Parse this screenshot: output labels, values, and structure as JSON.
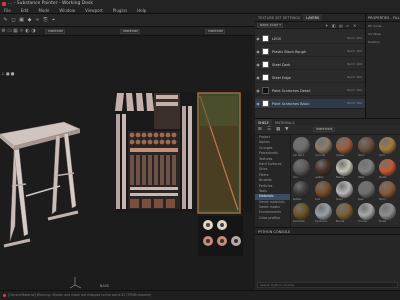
{
  "window": {
    "title": "... - Substance Painter - Working Desk"
  },
  "menu": [
    "File",
    "Edit",
    "Mode",
    "Window",
    "Viewport",
    "Plugins",
    "Help"
  ],
  "viewport_bar": {
    "left_dropdown": "Material",
    "mid_dropdown": "Material",
    "right_dropdown": "Material"
  },
  "texture_set_tabs": [
    {
      "label": "TEXTURE SET SETTINGS",
      "active": false
    },
    {
      "label": "LAYERS",
      "active": true
    }
  ],
  "layers": {
    "blend_mode": "Base color",
    "items": [
      {
        "name": "LEGS",
        "blend": "Norm\n100",
        "thumb": "white",
        "selected": false
      },
      {
        "name": "Plastic Black Rough",
        "blend": "Norm\n100",
        "thumb": "white",
        "selected": false
      },
      {
        "name": "Steel Dark",
        "blend": "Norm\n100",
        "thumb": "white",
        "selected": false
      },
      {
        "name": "Steel Edge",
        "blend": "Norm\n100",
        "thumb": "white",
        "selected": false
      },
      {
        "name": "Paint Scratches Detail",
        "blend": "Norm\n100",
        "thumb": "dark",
        "selected": false
      },
      {
        "name": "Paint Scratches Basic",
        "blend": "Norm\n100",
        "thumb": "white",
        "selected": true
      }
    ]
  },
  "properties": {
    "title": "PROPERTIES - FILL",
    "rows": [
      "Fill mode",
      "UV Wrap",
      "Position"
    ]
  },
  "shelf": {
    "tabs": [
      {
        "label": "SHELF",
        "active": true
      },
      {
        "label": "MATERIALS",
        "active": false
      }
    ],
    "search_label": "Materials",
    "categories": [
      "Project",
      "Alphas",
      "Grunges",
      "Procedurals",
      "Textures",
      "Hard Surfaces",
      "Skins",
      "Filters",
      "Brushes",
      "Particles",
      "Tools",
      "Materials",
      "Smart materials",
      "Smart masks",
      "Environments",
      "Color profiles"
    ],
    "selected_category": "Materials",
    "materials": [
      {
        "label": "Car Paint",
        "color": "#6e6e6e"
      },
      {
        "label": "Concrete",
        "color": "#8b7d6a"
      },
      {
        "label": "Copper",
        "color": "#9c5a3a"
      },
      {
        "label": "Fabric",
        "color": "#6b4f3e"
      },
      {
        "label": "Gold",
        "color": "#a27a3a"
      },
      {
        "label": "Iron",
        "color": "#5a5a5a"
      },
      {
        "label": "Leather",
        "color": "#4a2f24"
      },
      {
        "label": "Marble",
        "color": "#c8c3b8"
      },
      {
        "label": "Metal",
        "color": "#808080"
      },
      {
        "label": "Plastic",
        "color": "#c7562f"
      },
      {
        "label": "Rubber",
        "color": "#3a3a3a"
      },
      {
        "label": "Rust",
        "color": "#7a4a2a"
      },
      {
        "label": "Silver",
        "color": "#b8b8b8"
      },
      {
        "label": "Steel",
        "color": "#6e6e6e"
      },
      {
        "label": "Wood",
        "color": "#8a5a34"
      },
      {
        "label": "Gold Dark",
        "color": "#6b5220"
      },
      {
        "label": "Aluminium",
        "color": "#9aa0a5"
      },
      {
        "label": "Bronze",
        "color": "#7a6034"
      },
      {
        "label": "Chrome",
        "color": "#a8a8a8"
      },
      {
        "label": "Nickel",
        "color": "#8f8f8f"
      }
    ]
  },
  "console": {
    "title": "PYTHON CONSOLE",
    "placeholder": "Search Python console"
  },
  "status": {
    "message": "[GenericMaterial] Warning: Shader and mesh are mapped to the same ID (TPMM channel)"
  },
  "viewport_label": "BASE"
}
